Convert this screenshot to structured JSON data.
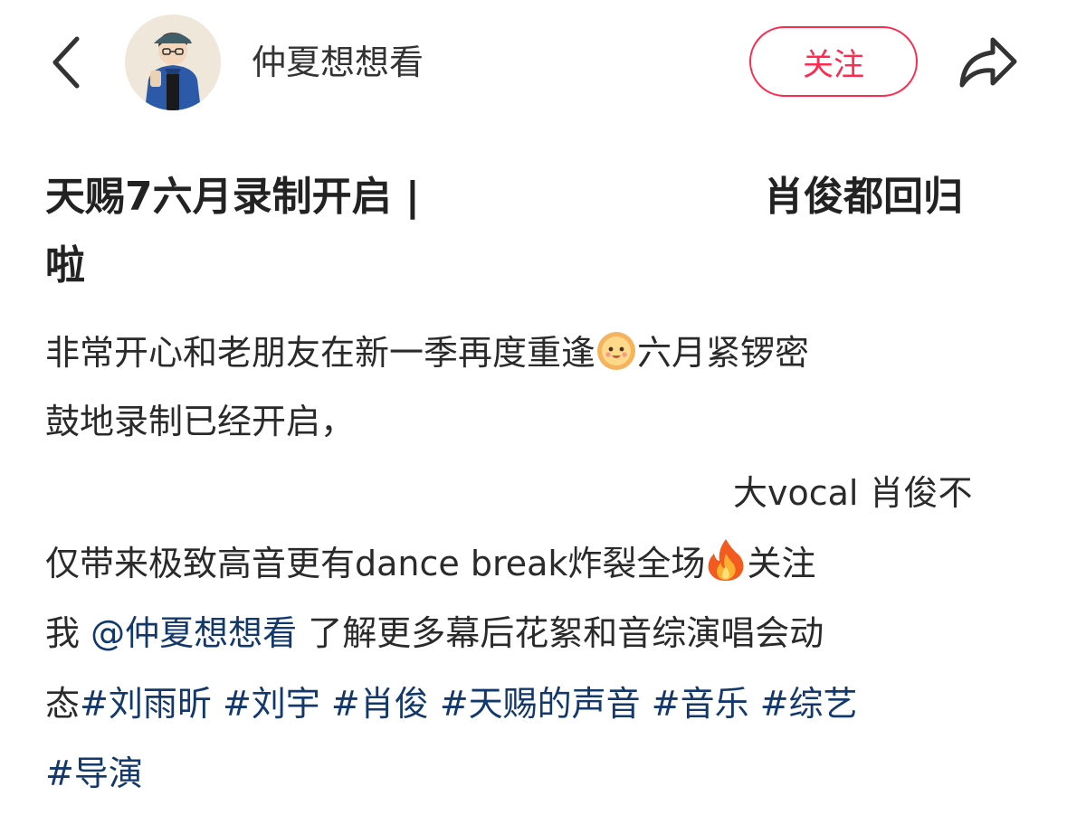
{
  "header": {
    "back_icon": "chevron-left-icon",
    "avatar_icon": "user-avatar-illustration",
    "author_name": "仲夏想想看",
    "follow_label": "关注",
    "share_icon": "share-arrow-icon",
    "accent_color": "#ff2a4f"
  },
  "post": {
    "title_part1": "天赐7六月录制开启 |",
    "title_part2": "肖俊都回归",
    "title_part3": "啦",
    "line1_a": "非常开心和老朋友在新一季再度重逢",
    "line1_emoji": "smiling-sun-emoji",
    "line1_b": "六月紧锣密",
    "line2": "鼓地录制已经开启，",
    "line3": "大vocal 肖俊不",
    "line4_a": "仅带来极致高音更有dance break炸裂全场",
    "line4_emoji": "fire-emoji",
    "line4_b": "关注",
    "line5_a": "我",
    "mention": "@仲夏想想看",
    "line5_b": "了解更多幕后花絮和音综演唱会动",
    "line6_a": "态",
    "tags": [
      "#刘雨昕",
      "#刘宇",
      "#肖俊",
      "#天赐的声音",
      "#音乐",
      "#综艺",
      "#导演"
    ],
    "link_color": "#13386c"
  }
}
